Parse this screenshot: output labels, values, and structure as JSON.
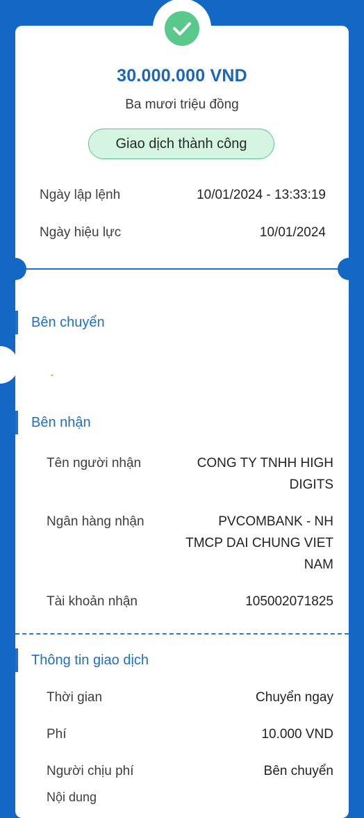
{
  "header": {
    "amount": "30.000.000 VND",
    "amount_words": "Ba mươi triệu đồng",
    "status": "Giao dịch thành công"
  },
  "summary": {
    "order_date_label": "Ngày lập lệnh",
    "order_date_value": "10/01/2024 - 13:33:19",
    "effective_date_label": "Ngày hiệu lực",
    "effective_date_value": "10/01/2024"
  },
  "sender": {
    "title": "Bên chuyển"
  },
  "receiver": {
    "title": "Bên nhận",
    "name_label": "Tên người nhận",
    "name_line1": "CONG TY TNHH HIGH",
    "name_line2": "DIGITS",
    "bank_label": "Ngân hàng nhận",
    "bank_line1": "PVCOMBANK - NH",
    "bank_line2": "TMCP DAI CHUNG VIET",
    "bank_line3": "NAM",
    "account_label": "Tài khoản nhận",
    "account_value": "105002071825"
  },
  "transaction": {
    "title": "Thông tin giao dịch",
    "time_label": "Thời gian",
    "time_value": "Chuyển ngay",
    "fee_label": "Phí",
    "fee_value": "10.000 VND",
    "payer_label": "Người chịu phí",
    "payer_value": "Bên chuyển",
    "content_label": "Nội dung"
  },
  "colors": {
    "background": "#1268c4",
    "accent": "#1d6fc9",
    "success": "#58c98a",
    "success_bg": "#d6f4e2"
  },
  "icons": {
    "status": "check-icon"
  }
}
